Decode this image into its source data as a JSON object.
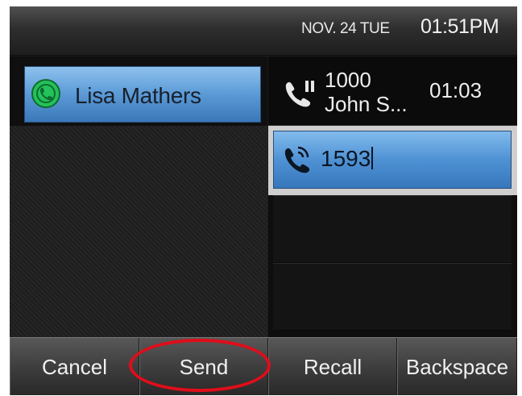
{
  "status": {
    "date": "NOV. 24 TUE",
    "time": "01:51PM"
  },
  "line": {
    "name": "Lisa Mathers",
    "icon": "line-status-icon"
  },
  "calls": {
    "held": {
      "number": "1000",
      "caller": "John S...",
      "duration": "01:03",
      "icon": "call-hold-icon"
    },
    "dialing": {
      "digits": "1593",
      "icon": "active-call-icon"
    }
  },
  "softkeys": [
    "Cancel",
    "Send",
    "Recall",
    "Backspace"
  ],
  "colors": {
    "selection": "#5b9ad6",
    "line_icon": "#23c25a",
    "annotation": "#e00d1a"
  }
}
